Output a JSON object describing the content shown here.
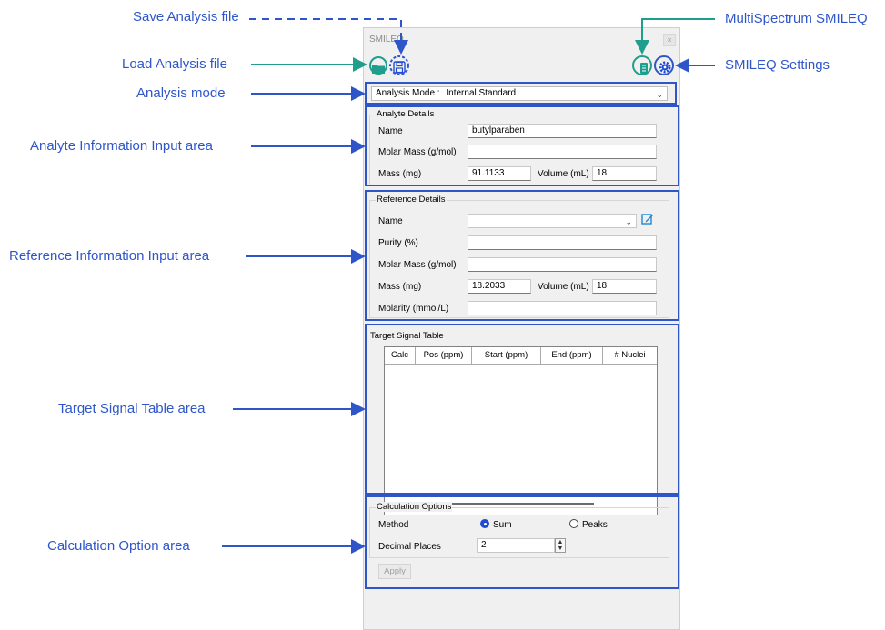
{
  "colors": {
    "callout": "#2f56c9",
    "green_highlight": "#1f9e8e",
    "radio_selected": "#1e4ad6"
  },
  "callouts": {
    "save_analysis": "Save Analysis file",
    "load_analysis": "Load Analysis file",
    "analysis_mode": "Analysis mode",
    "analyte_area": "Analyte Information Input area",
    "reference_area": "Reference Information Input area",
    "target_area": "Target Signal Table area",
    "calc_area": "Calculation Option area",
    "multispectrum": "MultiSpectrum SMILEQ",
    "settings": "SMILEQ Settings"
  },
  "window": {
    "title": "SMILEQ",
    "close": "×",
    "toolbar_icons": [
      "folder-icon",
      "save-icon",
      "multispectrum-icon",
      "gear-icon"
    ]
  },
  "analysis_mode": {
    "label": "Analysis Mode :",
    "value": "Internal Standard"
  },
  "analyte": {
    "title": "Analyte Details",
    "name_label": "Name",
    "name_value": "butylparaben",
    "molar_mass_label": "Molar Mass (g/mol)",
    "molar_mass_value": "",
    "mass_label": "Mass (mg)",
    "mass_value": "91.1133",
    "volume_label": "Volume (mL)",
    "volume_value": "18"
  },
  "reference": {
    "title": "Reference Details",
    "name_label": "Name",
    "name_value": "",
    "purity_label": "Purity (%)",
    "purity_value": "",
    "molar_mass_label": "Molar Mass (g/mol)",
    "molar_mass_value": "",
    "mass_label": "Mass (mg)",
    "mass_value": "18.2033",
    "volume_label": "Volume (mL)",
    "volume_value": "18",
    "molarity_label": "Molarity (mmol/L)",
    "molarity_value": ""
  },
  "target_table": {
    "title": "Target Signal Table",
    "columns": [
      "Calc",
      "Pos (ppm)",
      "Start (ppm)",
      "End (ppm)",
      "# Nuclei"
    ],
    "rows": []
  },
  "calc_options": {
    "title": "Calculation Options",
    "method_label": "Method",
    "option_sum": "Sum",
    "option_peaks": "Peaks",
    "selected": "Sum",
    "decimal_label": "Decimal Places",
    "decimal_value": "2",
    "apply": "Apply"
  }
}
